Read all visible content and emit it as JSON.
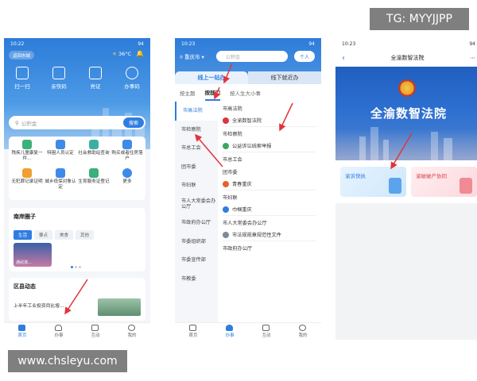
{
  "watermarks": {
    "top_right": "TG: MYYJJPP",
    "bottom_left": "www.chsleyu.com"
  },
  "phone1": {
    "status": {
      "time": "10:22",
      "battery": "94"
    },
    "back_label": "返回市城",
    "weather": "36°C",
    "quick_actions": [
      "扫一扫",
      "亲快码",
      "亮证",
      "办事码"
    ],
    "search": {
      "placeholder": "公积金",
      "button": "搜索"
    },
    "services": [
      "残疾儿童康复一件...",
      "特困人员认定",
      "社会救助站查询",
      "购买或者住房落户",
      "无犯罪记录证明",
      "城乡低保对象认定",
      "生育服务证登记",
      "更多"
    ],
    "circle": {
      "title": "南岸圈子",
      "tags": [
        "生活",
        "要点",
        "美食",
        "其他"
      ],
      "active_tag": "生活",
      "image_caption": "通武涨..."
    },
    "news": {
      "title": "区县动态",
      "headline": "上半年工业投资同比增..."
    },
    "tabbar": [
      {
        "label": "首页",
        "active": true
      },
      {
        "label": "办事",
        "active": false
      },
      {
        "label": "互动",
        "active": false
      },
      {
        "label": "我的",
        "active": false
      }
    ]
  },
  "phone2": {
    "status": {
      "time": "10:23",
      "battery": "94"
    },
    "location": "重庆市",
    "search_placeholder": "公积金",
    "person_label": "个人",
    "segments": {
      "online": "线上一站办",
      "offline": "线下就近办"
    },
    "subtabs": [
      "按主题",
      "按部门",
      "按人生大小事"
    ],
    "active_subtab": "按部门",
    "departments": [
      "市高法院",
      "市检察院",
      "市总工会",
      "团市委",
      "市妇联",
      "市人大常委会办公厅",
      "市政府办公厅",
      "市委组织部",
      "市委宣传部",
      "市教委"
    ],
    "active_department": "市高法院",
    "right_items": [
      {
        "kind": "header",
        "text": "市高法院"
      },
      {
        "kind": "item",
        "text": "全渝数智法院",
        "color": "#d9363e"
      },
      {
        "kind": "header",
        "text": "市检察院"
      },
      {
        "kind": "item",
        "text": "公益诉讼线索举报",
        "color": "#3aa85c"
      },
      {
        "kind": "header",
        "text": "市总工会"
      },
      {
        "kind": "header",
        "text": "团市委"
      },
      {
        "kind": "item",
        "text": "青春重庆",
        "color": "#e6622d"
      },
      {
        "kind": "header",
        "text": "市妇联"
      },
      {
        "kind": "item",
        "text": "巾帼重庆",
        "color": "#2f7de1"
      },
      {
        "kind": "header",
        "text": "市人大常委会办公厅"
      },
      {
        "kind": "item",
        "text": "市法规规章规范性文件",
        "color": "#7d8a99"
      },
      {
        "kind": "header",
        "text": "市政府办公厅"
      }
    ],
    "tabbar": [
      {
        "label": "首页",
        "active": false
      },
      {
        "label": "办事",
        "active": true
      },
      {
        "label": "互动",
        "active": false
      },
      {
        "label": "我的",
        "active": false
      }
    ]
  },
  "phone3": {
    "status": {
      "time": "10:23",
      "battery": "94"
    },
    "title": "全渝数智法院",
    "banner_title": "全渝数智法院",
    "tiles": [
      {
        "label": "渝诉快执",
        "color": "#2f7de1"
      },
      {
        "label": "渝破破产协同",
        "color": "#d9444e"
      }
    ]
  }
}
